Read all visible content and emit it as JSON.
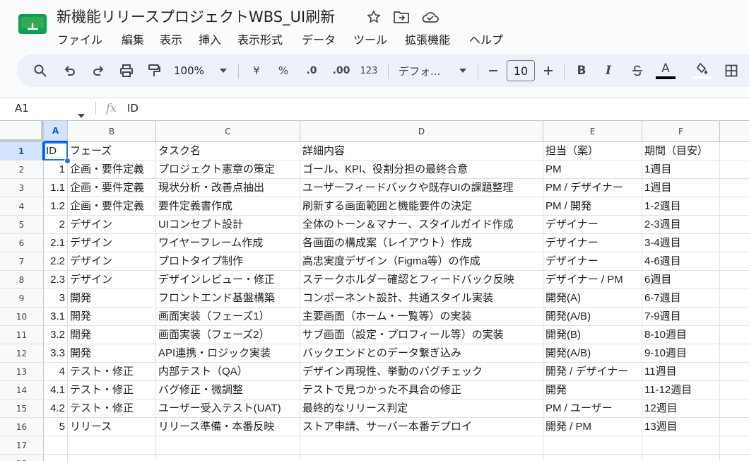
{
  "doc": {
    "title": "新機能リリースプロジェクトWBS_UI刷新",
    "menu": [
      "ファイル",
      "編集",
      "表示",
      "挿入",
      "表示形式",
      "データ",
      "ツール",
      "拡張機能",
      "ヘルプ"
    ],
    "brand_color": "#0f9d58"
  },
  "toolbar": {
    "zoom": "100%",
    "currency": "¥",
    "percent": "%",
    "decrease_decimal": ".0",
    "increase_decimal": ".00",
    "number_format": "123",
    "font": "デフォ...",
    "font_size": "10",
    "bold": "B",
    "italic": "I",
    "text_color": "A"
  },
  "formula_bar": {
    "name_box": "A1",
    "fx": "fx",
    "value": "ID"
  },
  "sheet": {
    "columns": [
      "A",
      "B",
      "C",
      "D",
      "E",
      "F"
    ],
    "selected_column": "A",
    "selected_row": 1,
    "rows": [
      {
        "n": "1",
        "cells": [
          "ID",
          "フェーズ",
          "タスク名",
          "詳細内容",
          "担当（案）",
          "期間（目安）"
        ]
      },
      {
        "n": "2",
        "cells": [
          "1",
          "企画・要件定義",
          "プロジェクト憲章の策定",
          "ゴール、KPI、役割分担の最終合意",
          "PM",
          "1週目"
        ]
      },
      {
        "n": "3",
        "cells": [
          "1.1",
          "企画・要件定義",
          "現状分析・改善点抽出",
          "ユーザーフィードバックや既存UIの課題整理",
          "PM / デザイナー",
          "1週目"
        ]
      },
      {
        "n": "4",
        "cells": [
          "1.2",
          "企画・要件定義",
          "要件定義書作成",
          "刷新する画面範囲と機能要件の決定",
          "PM / 開発",
          "1-2週目"
        ]
      },
      {
        "n": "5",
        "cells": [
          "2",
          "デザイン",
          "UIコンセプト設計",
          "全体のトーン＆マナー、スタイルガイド作成",
          "デザイナー",
          "2-3週目"
        ]
      },
      {
        "n": "6",
        "cells": [
          "2.1",
          "デザイン",
          "ワイヤーフレーム作成",
          "各画面の構成案（レイアウト）作成",
          "デザイナー",
          "3-4週目"
        ]
      },
      {
        "n": "7",
        "cells": [
          "2.2",
          "デザイン",
          "プロトタイプ制作",
          "高忠実度デザイン（Figma等）の作成",
          "デザイナー",
          "4-6週目"
        ]
      },
      {
        "n": "8",
        "cells": [
          "2.3",
          "デザイン",
          "デザインレビュー・修正",
          "ステークホルダー確認とフィードバック反映",
          "デザイナー / PM",
          "6週目"
        ]
      },
      {
        "n": "9",
        "cells": [
          "3",
          "開発",
          "フロントエンド基盤構築",
          "コンポーネント設計、共通スタイル実装",
          "開発(A)",
          "6-7週目"
        ]
      },
      {
        "n": "10",
        "cells": [
          "3.1",
          "開発",
          "画面実装（フェーズ1）",
          "主要画面（ホーム・一覧等）の実装",
          "開発(A/B)",
          "7-9週目"
        ]
      },
      {
        "n": "11",
        "cells": [
          "3.2",
          "開発",
          "画面実装（フェーズ2）",
          "サブ画面（設定・プロフィール等）の実装",
          "開発(B)",
          "8-10週目"
        ]
      },
      {
        "n": "12",
        "cells": [
          "3.3",
          "開発",
          "API連携・ロジック実装",
          "バックエンドとのデータ繋ぎ込み",
          "開発(A/B)",
          "9-10週目"
        ]
      },
      {
        "n": "13",
        "cells": [
          "4",
          "テスト・修正",
          "内部テスト（QA）",
          "デザイン再現性、挙動のバグチェック",
          "開発 / デザイナー",
          "11週目"
        ]
      },
      {
        "n": "14",
        "cells": [
          "4.1",
          "テスト・修正",
          "バグ修正・微調整",
          "テストで見つかった不具合の修正",
          "開発",
          "11-12週目"
        ]
      },
      {
        "n": "15",
        "cells": [
          "4.2",
          "テスト・修正",
          "ユーザー受入テスト(UAT)",
          "最終的なリリース判定",
          "PM / ユーザー",
          "12週目"
        ]
      },
      {
        "n": "16",
        "cells": [
          "5",
          "リリース",
          "リリース準備・本番反映",
          "ストア申請、サーバー本番デプロイ",
          "開発 / PM",
          "13週目"
        ]
      },
      {
        "n": "17",
        "cells": [
          "",
          "",
          "",
          "",
          "",
          ""
        ]
      },
      {
        "n": "18",
        "cells": [
          "",
          "",
          "",
          "",
          "",
          ""
        ]
      }
    ]
  }
}
